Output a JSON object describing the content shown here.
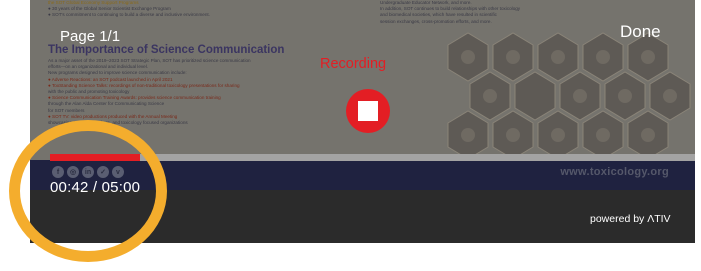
{
  "slide": {
    "lines_top": [
      "the SOT Global Economy Support Programs",
      "● 30 years of the Global Senior Scientist Exchange Program",
      "● SOT's commitment to continuing to build a diverse and inclusive environment."
    ],
    "heading": "The Importance of Science Communication",
    "body_lines": [
      "As a major asset of the 2019–2023 SOT Strategic Plan, SOT has prioritized science communication",
      "efforts—on an organizational and individual level.",
      "New programs designed to improve science communication include:",
      "● Adverse Reactions: an SOT podcast launched in April 2021",
      "● ToxStanding Science Talks: recordings of non-traditional toxicology presentations for sharing",
      "   with the public and promoting toxicology",
      "● Science Communication Training Awards: provides science communication training",
      "   through the Alan Alda Center for Communicating Science",
      "   for SOT members",
      "● SOT TV: video productions produced with the Annual Meeting",
      "   showcasing SOT, its members, and toxicology focused organizations"
    ],
    "right_lines": [
      "Undergraduate Educator Network, and more.",
      "In addition, SOT continues to build relationships with other toxicology",
      "and biomedical societies, which have resulted in scientific",
      "session exchanges, cross-promotion efforts, and more."
    ],
    "footer_url": "www.toxicology.org",
    "social_icons": [
      "f",
      "◎",
      "in",
      "✓",
      "v"
    ]
  },
  "overlay": {
    "page_label": "Page 1/1",
    "done_label": "Done",
    "recording_label": "Recording",
    "time_readout": "00:42 / 05:00",
    "powered_by": "powered by ΛTIV"
  },
  "progress": {
    "elapsed_seconds": 42,
    "total_seconds": 300,
    "fraction": 0.14
  },
  "colors": {
    "recording_red": "#e31e24",
    "highlight_orange": "#f4ad2d",
    "panel_dark": "#2b2b2b",
    "progress_track": "#a3a3a3"
  }
}
